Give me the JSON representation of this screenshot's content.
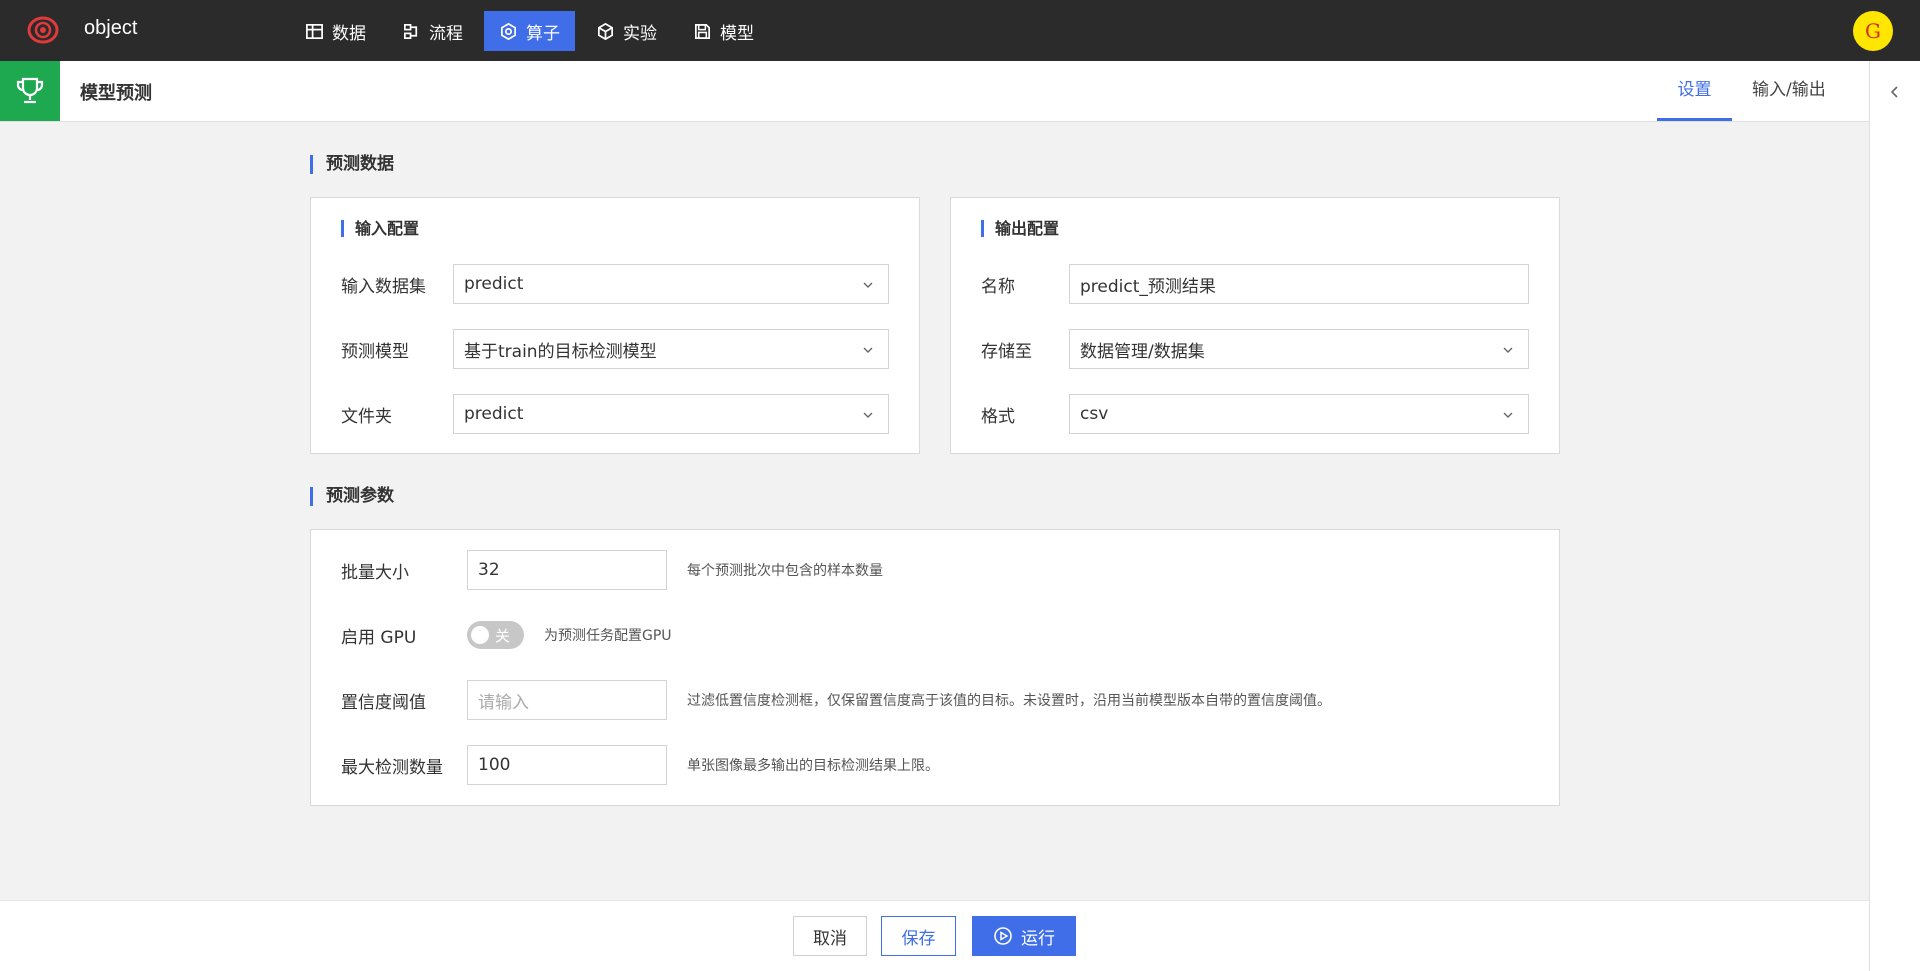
{
  "app": {
    "name": "object"
  },
  "nav": [
    {
      "label": "数据",
      "icon": "table-icon",
      "active": false
    },
    {
      "label": "流程",
      "icon": "flow-icon",
      "active": false
    },
    {
      "label": "算子",
      "icon": "hexagon-icon",
      "active": true
    },
    {
      "label": "实验",
      "icon": "cube-icon",
      "active": false
    },
    {
      "label": "模型",
      "icon": "save-icon",
      "active": false
    }
  ],
  "user": {
    "avatar_letter": "G"
  },
  "header": {
    "title": "模型预测"
  },
  "tabs": {
    "settings": "设置",
    "io": "输入/输出"
  },
  "sections": {
    "predict_data": "预测数据",
    "predict_params": "预测参数"
  },
  "input_config": {
    "title": "输入配置",
    "dataset_label": "输入数据集",
    "dataset_value": "predict",
    "model_label": "预测模型",
    "model_value": "基于train的目标检测模型",
    "folder_label": "文件夹",
    "folder_value": "predict"
  },
  "output_config": {
    "title": "输出配置",
    "name_label": "名称",
    "name_value": "predict_预测结果",
    "storage_label": "存储至",
    "storage_value": "数据管理/数据集",
    "format_label": "格式",
    "format_value": "csv"
  },
  "params": {
    "batch_label": "批量大小",
    "batch_value": "32",
    "batch_hint": "每个预测批次中包含的样本数量",
    "gpu_label": "启用 GPU",
    "gpu_toggle_text": "关",
    "gpu_hint": "为预测任务配置GPU",
    "conf_label": "置信度阈值",
    "conf_placeholder": "请输入",
    "conf_hint": "过滤低置信度检测框，仅保留置信度高于该值的目标。未设置时，沿用当前模型版本自带的置信度阈值。",
    "max_label": "最大检测数量",
    "max_value": "100",
    "max_hint": "单张图像最多输出的目标检测结果上限。"
  },
  "footer": {
    "cancel": "取消",
    "save": "保存",
    "run": "运行"
  },
  "colors": {
    "accent": "#3f6ee8",
    "topbar": "#2b2b2b",
    "trophy_bg": "#1ea84f",
    "avatar_bg": "#ffe600"
  }
}
